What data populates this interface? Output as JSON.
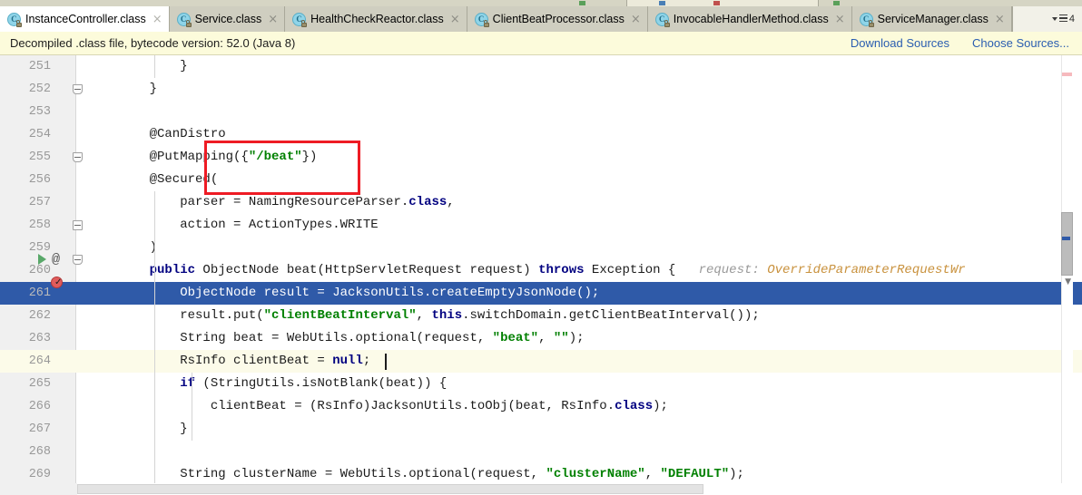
{
  "window": {
    "app": "IntelliJ IDEA editor",
    "toolbar_icons": [
      "green-dot-icon",
      "debug-icon",
      "bookmark-icon",
      "green-dot-icon"
    ]
  },
  "tabs": {
    "items": [
      {
        "label": "InstanceController.class",
        "icon": "java-class-file-icon",
        "active": true,
        "close": "×"
      },
      {
        "label": "Service.class",
        "icon": "java-class-file-icon",
        "active": false,
        "close": "×"
      },
      {
        "label": "HealthCheckReactor.class",
        "icon": "java-class-file-icon",
        "active": false,
        "close": "×"
      },
      {
        "label": "ClientBeatProcessor.class",
        "icon": "java-class-file-icon",
        "active": false,
        "close": "×"
      },
      {
        "label": "InvocableHandlerMethod.class",
        "icon": "java-class-file-icon",
        "active": false,
        "close": "×"
      },
      {
        "label": "ServiceManager.class",
        "icon": "java-class-file-icon",
        "active": false,
        "close": "×"
      }
    ],
    "overflow_count": "4"
  },
  "banner": {
    "message": "Decompiled .class file, bytecode version: 52.0 (Java 8)",
    "download_sources": "Download Sources",
    "choose_sources": "Choose Sources...",
    "link_color": "#2a5db0",
    "background": "#fcfbdb"
  },
  "editor": {
    "selection_color": "#2f5aa8",
    "caret_line_color": "#fcfbe9",
    "keyword_color": "#000080",
    "string_color": "#008000",
    "hint_value_color": "#c9923e",
    "annotation_rect_color": "#ee1b24",
    "lines": [
      {
        "number": "251",
        "tokens": [
          {
            "t": "        }",
            "c": "plain"
          }
        ]
      },
      {
        "number": "252",
        "tokens": [
          {
            "t": "    }",
            "c": "plain"
          }
        ]
      },
      {
        "number": "253",
        "tokens": [
          {
            "t": "",
            "c": "plain"
          }
        ]
      },
      {
        "number": "254",
        "tokens": [
          {
            "t": "    @CanDistro",
            "c": "plain"
          }
        ]
      },
      {
        "number": "255",
        "tokens": [
          {
            "t": "    @PutMapping({",
            "c": "plain"
          },
          {
            "t": "\"/beat\"",
            "c": "str"
          },
          {
            "t": "})",
            "c": "plain"
          }
        ]
      },
      {
        "number": "256",
        "tokens": [
          {
            "t": "    @Secured(",
            "c": "plain"
          }
        ]
      },
      {
        "number": "257",
        "tokens": [
          {
            "t": "        parser = NamingResourceParser.",
            "c": "plain"
          },
          {
            "t": "class",
            "c": "kw"
          },
          {
            "t": ",",
            "c": "plain"
          }
        ]
      },
      {
        "number": "258",
        "tokens": [
          {
            "t": "        action = ActionTypes.WRITE",
            "c": "plain"
          }
        ]
      },
      {
        "number": "259",
        "tokens": [
          {
            "t": "    )",
            "c": "plain"
          }
        ]
      },
      {
        "number": "260",
        "tokens": [
          {
            "t": "    ",
            "c": "plain"
          },
          {
            "t": "public",
            "c": "kw"
          },
          {
            "t": " ObjectNode beat(HttpServletRequest request) ",
            "c": "plain"
          },
          {
            "t": "throws",
            "c": "kw"
          },
          {
            "t": " Exception {",
            "c": "plain"
          }
        ],
        "inline_hint": {
          "name": "request:",
          "value": "OverrideParameterRequestWr"
        }
      },
      {
        "number": "261",
        "selected": true,
        "tokens": [
          {
            "t": "        ObjectNode result = JacksonUtils.createEmptyJsonNode();",
            "c": "sel-text"
          }
        ]
      },
      {
        "number": "262",
        "tokens": [
          {
            "t": "        result.put(",
            "c": "plain"
          },
          {
            "t": "\"clientBeatInterval\"",
            "c": "str"
          },
          {
            "t": ", ",
            "c": "plain"
          },
          {
            "t": "this",
            "c": "kw"
          },
          {
            "t": ".switchDomain.getClientBeatInterval());",
            "c": "plain"
          }
        ]
      },
      {
        "number": "263",
        "tokens": [
          {
            "t": "        String beat = WebUtils.optional(request, ",
            "c": "plain"
          },
          {
            "t": "\"beat\"",
            "c": "str"
          },
          {
            "t": ", ",
            "c": "plain"
          },
          {
            "t": "\"\"",
            "c": "str"
          },
          {
            "t": ");",
            "c": "plain"
          }
        ]
      },
      {
        "number": "264",
        "caret_line": true,
        "tokens": [
          {
            "t": "        RsInfo clientBeat = ",
            "c": "plain"
          },
          {
            "t": "null",
            "c": "kw"
          },
          {
            "t": ";",
            "c": "plain"
          }
        ]
      },
      {
        "number": "265",
        "tokens": [
          {
            "t": "        ",
            "c": "plain"
          },
          {
            "t": "if",
            "c": "kw"
          },
          {
            "t": " (StringUtils.isNotBlank(beat)) {",
            "c": "plain"
          }
        ]
      },
      {
        "number": "266",
        "tokens": [
          {
            "t": "            clientBeat = (RsInfo)JacksonUtils.toObj(beat, RsInfo.",
            "c": "plain"
          },
          {
            "t": "class",
            "c": "kw"
          },
          {
            "t": ");",
            "c": "plain"
          }
        ]
      },
      {
        "number": "267",
        "tokens": [
          {
            "t": "        }",
            "c": "plain"
          }
        ]
      },
      {
        "number": "268",
        "tokens": [
          {
            "t": "",
            "c": "plain"
          }
        ]
      },
      {
        "number": "269",
        "tokens": [
          {
            "t": "        String clusterName = WebUtils.optional(request, ",
            "c": "plain"
          },
          {
            "t": "\"clusterName\"",
            "c": "str"
          },
          {
            "t": ", ",
            "c": "plain"
          },
          {
            "t": "\"DEFAULT\"",
            "c": "str"
          },
          {
            "t": ");",
            "c": "plain"
          }
        ]
      }
    ],
    "gutter_markers": {
      "run_line": "260",
      "override_marker": "@",
      "breakpoint_line": "261"
    }
  }
}
